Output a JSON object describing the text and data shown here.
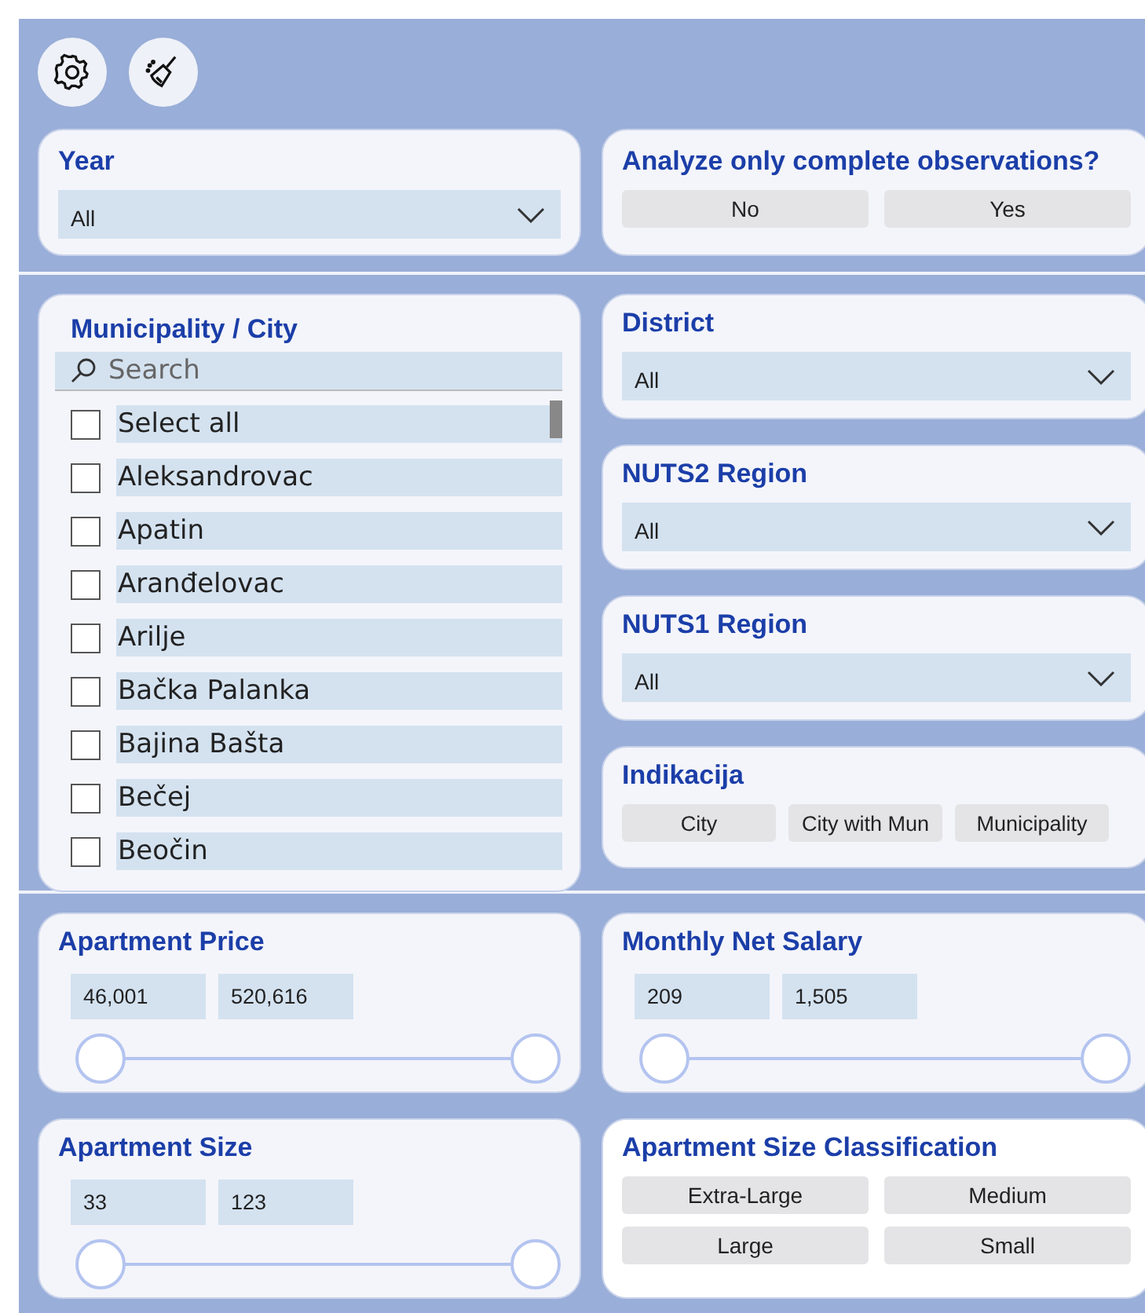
{
  "toolbar": {
    "buttons": [
      {
        "kind": "settings"
      },
      {
        "kind": "clear"
      }
    ]
  },
  "year": {
    "title": "Year",
    "value": "All"
  },
  "complete_observations": {
    "title": "Analyze only complete observations?",
    "options": [
      {
        "label": "No",
        "selected": false
      },
      {
        "label": "Yes",
        "selected": false
      }
    ]
  },
  "municipality": {
    "title": "Municipality / City",
    "search": {
      "placeholder": "Search"
    },
    "items": [
      {
        "label": "Select all",
        "checked": false
      },
      {
        "label": "Aleksandrovac",
        "checked": false
      },
      {
        "label": "Apatin",
        "checked": false
      },
      {
        "label": "Aranđelovac",
        "checked": false
      },
      {
        "label": "Arilje",
        "checked": false
      },
      {
        "label": "Bačka Palanka",
        "checked": false
      },
      {
        "label": "Bajina Bašta",
        "checked": false
      },
      {
        "label": "Bečej",
        "checked": false
      },
      {
        "label": "Beočin",
        "checked": false
      }
    ]
  },
  "dropdowns": [
    {
      "title": "District",
      "value": "All"
    },
    {
      "title": "NUTS2 Region",
      "value": "All"
    },
    {
      "title": "NUTS1 Region",
      "value": "All"
    }
  ],
  "indikacija": {
    "title": "Indikacija",
    "options": [
      {
        "label": "City",
        "selected": false
      },
      {
        "label": "City with Mun",
        "selected": false
      },
      {
        "label": "Municipality",
        "selected": false
      }
    ]
  },
  "ranges": [
    {
      "title": "Apartment Price",
      "low": "46,001",
      "high": "520,616",
      "thumbs": [
        {
          "level": 0
        },
        {
          "level": 1
        }
      ]
    },
    {
      "title": "Monthly Net Salary",
      "low": "209",
      "high": "1,505",
      "thumbs": [
        {
          "level": 0
        },
        {
          "level": 1
        }
      ]
    },
    {
      "title": "Apartment Size",
      "low": "33",
      "high": "123",
      "thumbs": [
        {
          "level": 0
        },
        {
          "level": 1
        }
      ]
    }
  ],
  "size_classification": {
    "title": "Apartment Size Classification",
    "options": [
      {
        "label": "Extra-Large",
        "selected": false
      },
      {
        "label": "Medium",
        "selected": false
      },
      {
        "label": "Large",
        "selected": false
      },
      {
        "label": "Small",
        "selected": false
      }
    ]
  }
}
